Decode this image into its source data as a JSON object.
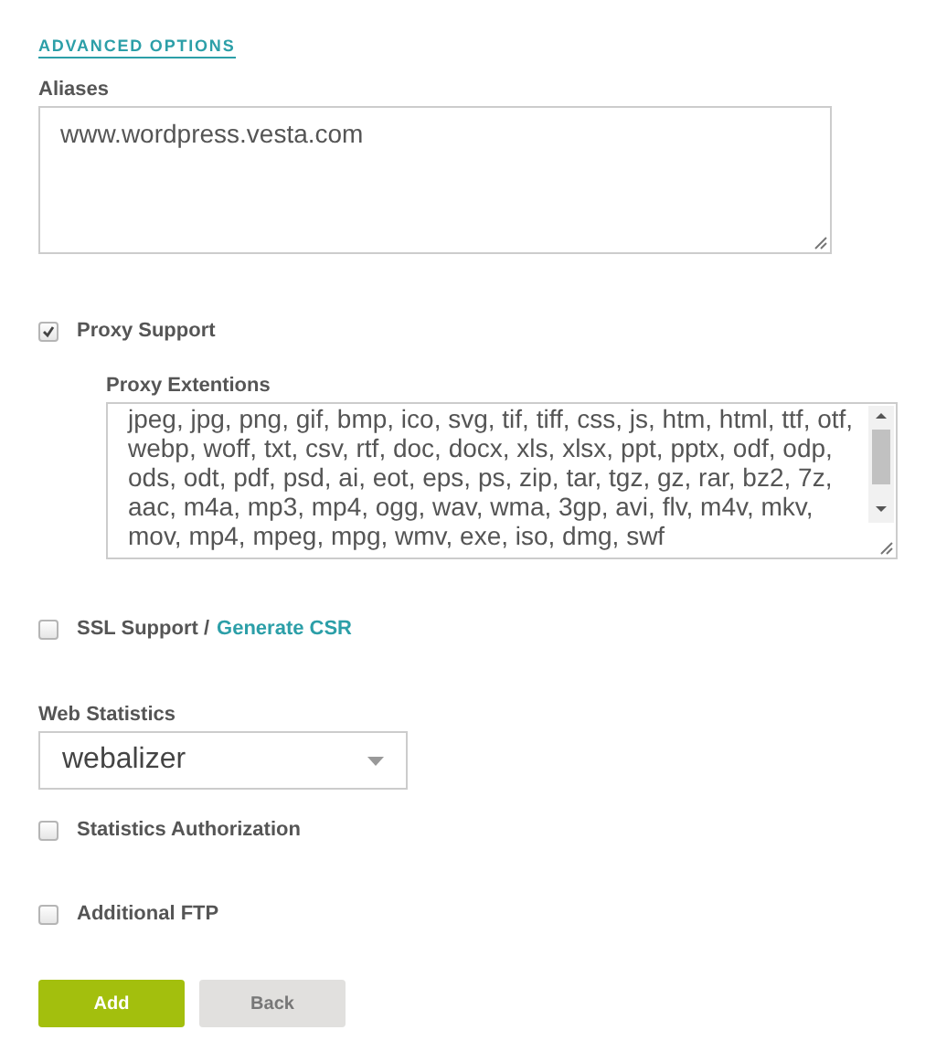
{
  "advanced_options_link": "ADVANCED OPTIONS",
  "aliases": {
    "label": "Aliases",
    "value": "www.wordpress.vesta.com"
  },
  "proxy_support": {
    "label": "Proxy Support",
    "checked": true
  },
  "proxy_extensions": {
    "label": "Proxy Extentions",
    "value": "jpeg, jpg, png, gif, bmp, ico, svg, tif, tiff, css, js, htm, html, ttf, otf, webp, woff, txt, csv, rtf, doc, docx, xls, xlsx, ppt, pptx, odf, odp, ods, odt, pdf, psd, ai, eot, eps, ps, zip, tar, tgz, gz, rar, bz2, 7z, aac, m4a, mp3, mp4, ogg, wav, wma, 3gp, avi, flv, m4v, mkv, mov, mp4, mpeg, mpg, wmv, exe, iso, dmg, swf"
  },
  "ssl_support": {
    "label": "SSL Support /",
    "link": "Generate CSR",
    "checked": false
  },
  "web_statistics": {
    "label": "Web Statistics",
    "value": "webalizer"
  },
  "statistics_authorization": {
    "label": "Statistics Authorization",
    "checked": false
  },
  "additional_ftp": {
    "label": "Additional FTP",
    "checked": false
  },
  "buttons": [
    {
      "label": "Add",
      "kind": "primary"
    },
    {
      "label": "Back",
      "kind": "secondary"
    }
  ]
}
